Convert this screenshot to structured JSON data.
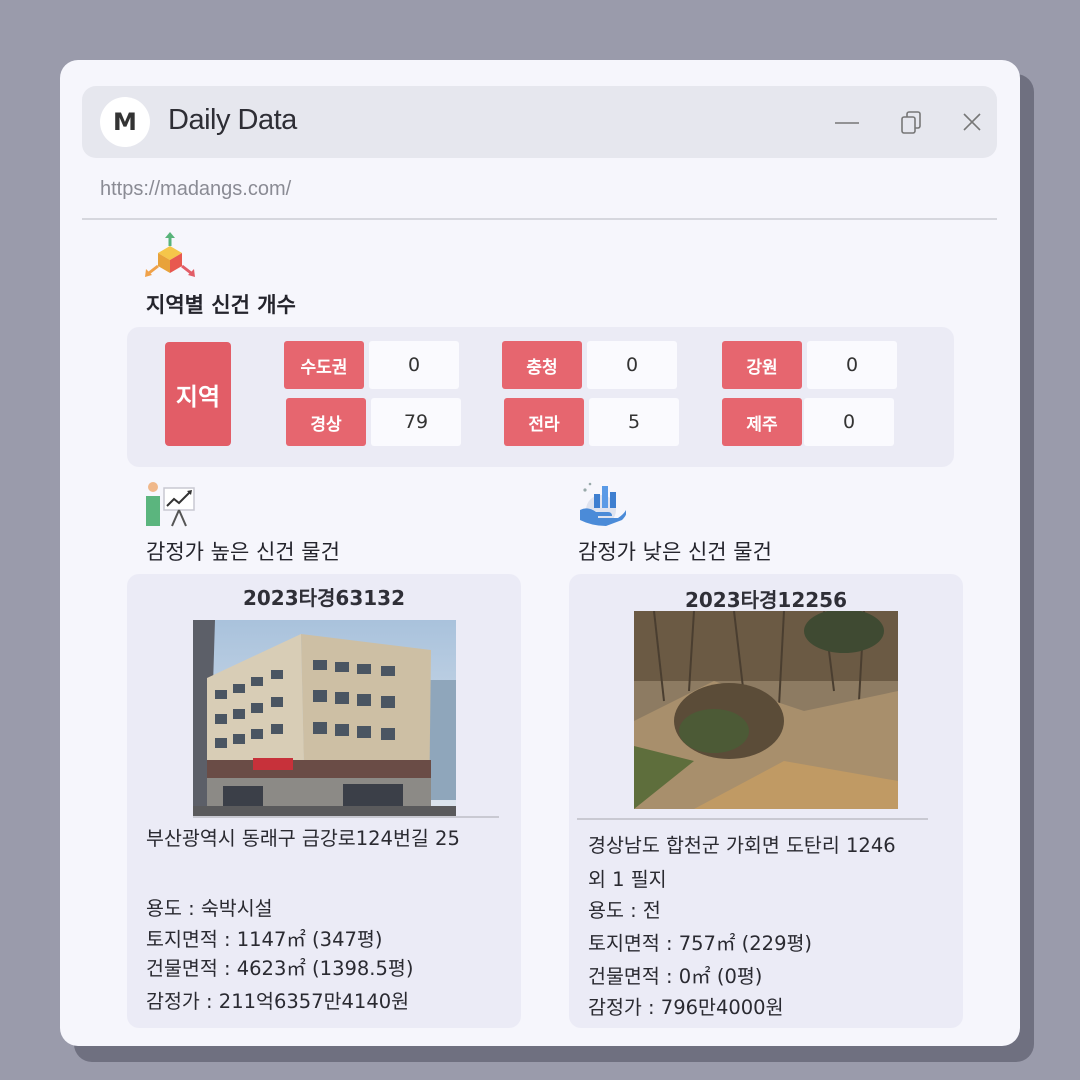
{
  "window": {
    "avatar_letter": "M",
    "title": "Daily Data",
    "url": "https://madangs.com/"
  },
  "region_section": {
    "icon": "cube-arrows-icon",
    "title": "지역별 신건 개수",
    "main_label": "지역",
    "regions": [
      {
        "name": "수도권",
        "count": "0"
      },
      {
        "name": "충청",
        "count": "0"
      },
      {
        "name": "강원",
        "count": "0"
      },
      {
        "name": "경상",
        "count": "79"
      },
      {
        "name": "전라",
        "count": "5"
      },
      {
        "name": "제주",
        "count": "0"
      }
    ]
  },
  "high_section": {
    "icon": "presentation-chart-icon",
    "title": "감정가 높은 신건 물건",
    "case_no": "2023타경63132",
    "address": "부산광역시 동래구 금강로124번길 25",
    "usage": "용도 : 숙박시설",
    "land_area": "토지면적 : 1147㎡ (347평)",
    "building_area": "건물면적 : 4623㎡ (1398.5평)",
    "appraisal": "감정가 : 211억6357만4140원"
  },
  "low_section": {
    "icon": "hand-bar-chart-icon",
    "title": "감정가 낮은 신건 물건",
    "case_no": "2023타경12256",
    "address_line1": "경상남도 합천군 가회면 도탄리 1246",
    "address_line2": "외 1 필지",
    "usage": "용도 :  전",
    "land_area": "토지면적 : 757㎡ (229평)",
    "building_area": "건물면적 : 0㎡ (0평)",
    "appraisal": "감정가 : 796만4000원"
  },
  "colors": {
    "accent": "#e6666f",
    "accent_dark": "#e25d67",
    "panel": "#ebebf5",
    "window": "#f6f6fc",
    "backdrop": "#9a9bab"
  }
}
